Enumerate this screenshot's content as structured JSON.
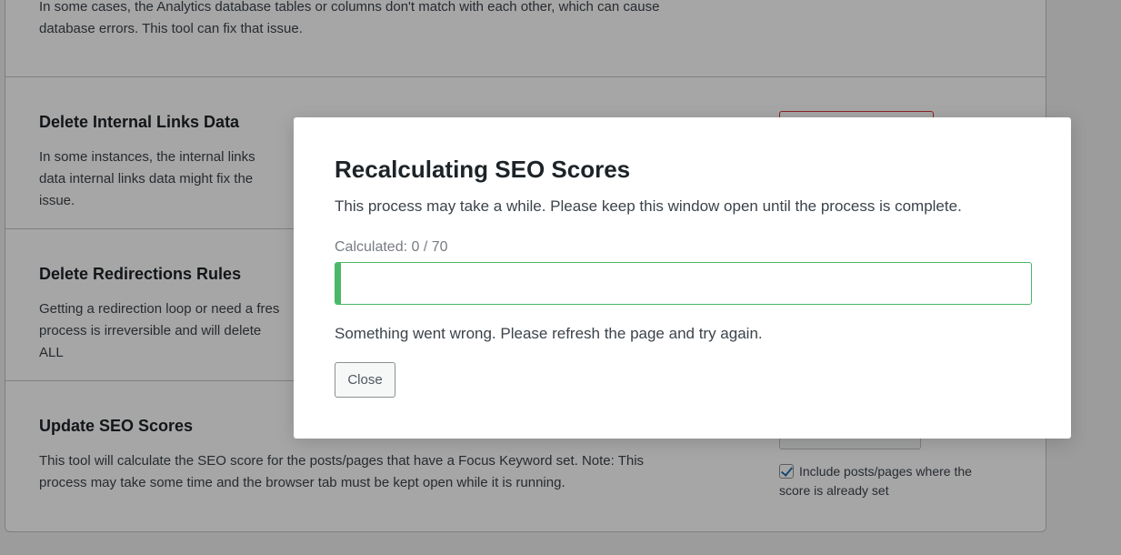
{
  "sections": [
    {
      "title": "",
      "description": "In some cases, the Analytics database tables or columns don't match with each other, which can cause database errors. This tool can fix that issue."
    },
    {
      "title": "Delete Internal Links Data",
      "description": "In some instances, the internal links data internal links data might fix the issue."
    },
    {
      "title": "Delete Redirections Rules",
      "description": "Getting a redirection loop or need a fres process is irreversible and will delete ALL"
    },
    {
      "title": "Update SEO Scores",
      "description": "This tool will calculate the SEO score for the posts/pages that have a Focus Keyword set. Note: This process may take some time and the browser tab must be kept open while it is running.",
      "checkbox_label": "Include posts/pages where the score is already set",
      "checkbox_checked": true
    }
  ],
  "modal": {
    "title": "Recalculating SEO Scores",
    "description": "This process may take a while. Please keep this window open until the process is complete.",
    "calculated_text": "Calculated: 0 / 70",
    "progress": {
      "done": 0,
      "total": 70,
      "fill_fraction": 0.008
    },
    "error_message": "Something went wrong. Please refresh the page and try again.",
    "close_label": "Close"
  },
  "colors": {
    "progress_accent": "#4ab866",
    "danger": "#d63638",
    "checkbox_check": "#2271b1"
  }
}
